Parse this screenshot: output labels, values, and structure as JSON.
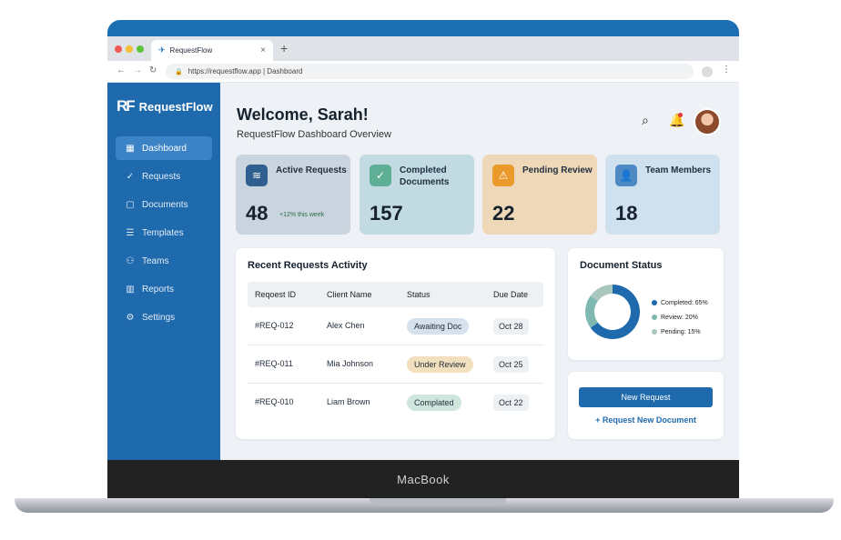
{
  "device": {
    "brand": "MacBook"
  },
  "browser": {
    "tab_title": "RequestFlow",
    "tab_close": "×",
    "new_tab": "+",
    "url": "https://requestflow.app | Dashboard"
  },
  "sidebar": {
    "logo_mark": "RF",
    "logo_text": "RequestFlow",
    "items": [
      {
        "label": "Dashboard",
        "icon": "dashboard-icon",
        "glyph": "▦",
        "active": true
      },
      {
        "label": "Requests",
        "icon": "check-circle-icon",
        "glyph": "✓",
        "active": false
      },
      {
        "label": "Documents",
        "icon": "document-icon",
        "glyph": "▢",
        "active": false
      },
      {
        "label": "Templates",
        "icon": "template-icon",
        "glyph": "☰",
        "active": false
      },
      {
        "label": "Teams",
        "icon": "teams-icon",
        "glyph": "⚇",
        "active": false
      },
      {
        "label": "Reports",
        "icon": "reports-icon",
        "glyph": "▥",
        "active": false
      },
      {
        "label": "Settings",
        "icon": "gear-icon",
        "glyph": "⚙",
        "active": false
      }
    ]
  },
  "header": {
    "welcome": "Welcome, Sarah!",
    "subtitle": "RequestFlow Dashboard Overview"
  },
  "stats": [
    {
      "label": "Active Requests",
      "value": "48",
      "trend": "+12% this week",
      "icon": "stack-icon",
      "glyph": "≋",
      "bg": "#c9d4de",
      "icon_bg": "#2f5f8e"
    },
    {
      "label": "Completed Documents",
      "value": "157",
      "trend": "",
      "icon": "check-icon",
      "glyph": "✓",
      "bg": "#c2dbe3",
      "icon_bg": "#5fae96"
    },
    {
      "label": "Pending Review",
      "value": "22",
      "trend": "",
      "icon": "warning-icon",
      "glyph": "⚠",
      "bg": "#eed8b8",
      "icon_bg": "#ea9a2b"
    },
    {
      "label": "Team Members",
      "value": "18",
      "trend": "",
      "icon": "user-icon",
      "glyph": "👤",
      "bg": "#cfe0ef",
      "icon_bg": "#4d8ac4"
    }
  ],
  "activity": {
    "title": "Recent Requests Activity",
    "columns": [
      "Reqoest ID",
      "Client Name",
      "Status",
      "Due Date"
    ],
    "rows": [
      {
        "id": "#REQ-012",
        "client": "Alex Chen",
        "status": "Awaiting Doc",
        "status_bg": "#d5e1ec",
        "due": "Oct 28"
      },
      {
        "id": "#REQ-011",
        "client": "Mia Johnson",
        "status": "Under Review",
        "status_bg": "#f1dfbd",
        "due": "Oct 25"
      },
      {
        "id": "#REQ-010",
        "client": "Liam Brown",
        "status": "Complated",
        "status_bg": "#cfe6dc",
        "due": "Oct 22"
      }
    ]
  },
  "document_status": {
    "title": "Document Status",
    "legend": [
      "Completed: 65%",
      "Review: 20%",
      "Pending: 15%"
    ]
  },
  "chart_data": {
    "type": "pie",
    "categories": [
      "Completed",
      "Review",
      "Pending"
    ],
    "values": [
      65,
      20,
      15
    ],
    "colors": [
      "#1e6aad",
      "#7fb8b0",
      "#a9c6bf"
    ]
  },
  "actions": {
    "new_request": "New Request",
    "request_document": "+ Request New Document"
  }
}
